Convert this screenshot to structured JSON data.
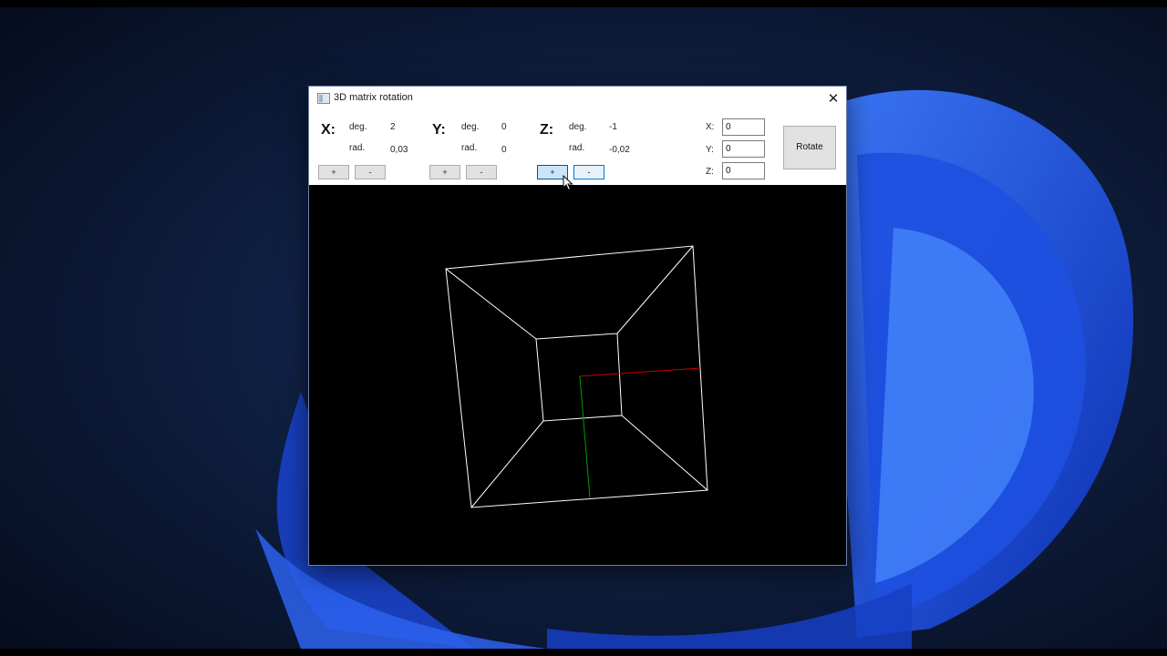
{
  "window": {
    "title": "3D matrix rotation",
    "close_glyph": "✕"
  },
  "controls": {
    "deg_label": "deg.",
    "rad_label": "rad.",
    "plus_label": "+",
    "minus_label": "-",
    "x": {
      "letter": "X:",
      "deg": "2",
      "rad": "0,03"
    },
    "y": {
      "letter": "Y:",
      "deg": "0",
      "rad": "0"
    },
    "z": {
      "letter": "Z:",
      "deg": "-1",
      "rad": "-0,02"
    }
  },
  "inputs": {
    "x": {
      "label": "X:",
      "value": "0"
    },
    "y": {
      "label": "Y:",
      "value": "0"
    },
    "z": {
      "label": "Z:",
      "value": "0"
    }
  },
  "rotate_label": "Rotate",
  "viewport": {
    "background": "#000000",
    "edge_color": "#ffffff",
    "x_axis_color": "#cc0000",
    "y_axis_color": "#00a000"
  },
  "icons": {
    "app": "app-window-icon",
    "close": "close-icon",
    "cursor": "mouse-cursor-icon"
  }
}
